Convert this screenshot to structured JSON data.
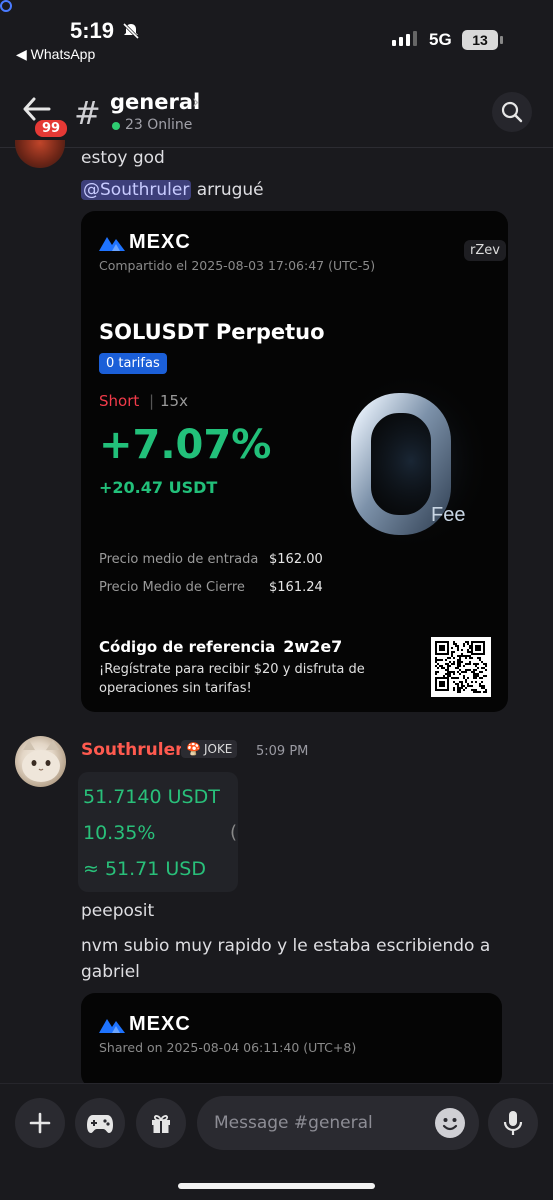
{
  "status_bar": {
    "time": "5:19",
    "back_app": "◀ WhatsApp",
    "network": "5G",
    "battery": "13"
  },
  "header": {
    "badge_count": "99",
    "channel_name": "general",
    "online_text": "23 Online"
  },
  "messages": {
    "m1_text": "estoy god",
    "m2_mention": "@Southruler",
    "m2_text": " arrugué",
    "card1": {
      "brand": "MEXC",
      "shared": "Compartido el 2025-08-03 17:06:47 (UTC-5)",
      "user_tag": "rZev",
      "pair": "SOLUSDT Perpetuo",
      "fee_tag": "0 tarifas",
      "side": "Short",
      "separator": "|",
      "leverage": "15x",
      "pnl_pct": "+7.07%",
      "pnl_usdt": "+20.47 USDT",
      "entry_label": "Precio medio de entrada",
      "entry_value": "$162.00",
      "close_label": "Precio Medio de Cierre",
      "close_value": "$161.24",
      "ref_label": "Código de referencia",
      "ref_code": "2w2e7",
      "promo": "¡Regístrate para recibir $20 y disfruta de operaciones sin tarifas!",
      "zero_fee_label": "Fee"
    },
    "author": {
      "name": "Southruler",
      "role": "JOKE",
      "time": "5:09 PM"
    },
    "embed_lines": [
      "51.7140 USDT",
      "10.35%",
      "≈ 51.71 USD"
    ],
    "embed_paren": "(",
    "m3_text": "peeposit",
    "m4_text": "nvm subio muy rapido y le estaba escribiendo a gabriel",
    "card2": {
      "brand": "MEXC",
      "shared": "Shared on 2025-08-04 06:11:40 (UTC+8)"
    }
  },
  "composer": {
    "placeholder": "Message #general"
  },
  "colors": {
    "accent_green": "#22c07a",
    "short_red": "#f23b4a",
    "username_red": "#ff5a4f",
    "mention_bg": "#3d3f7a",
    "fee_blue": "#1b5fd8"
  }
}
